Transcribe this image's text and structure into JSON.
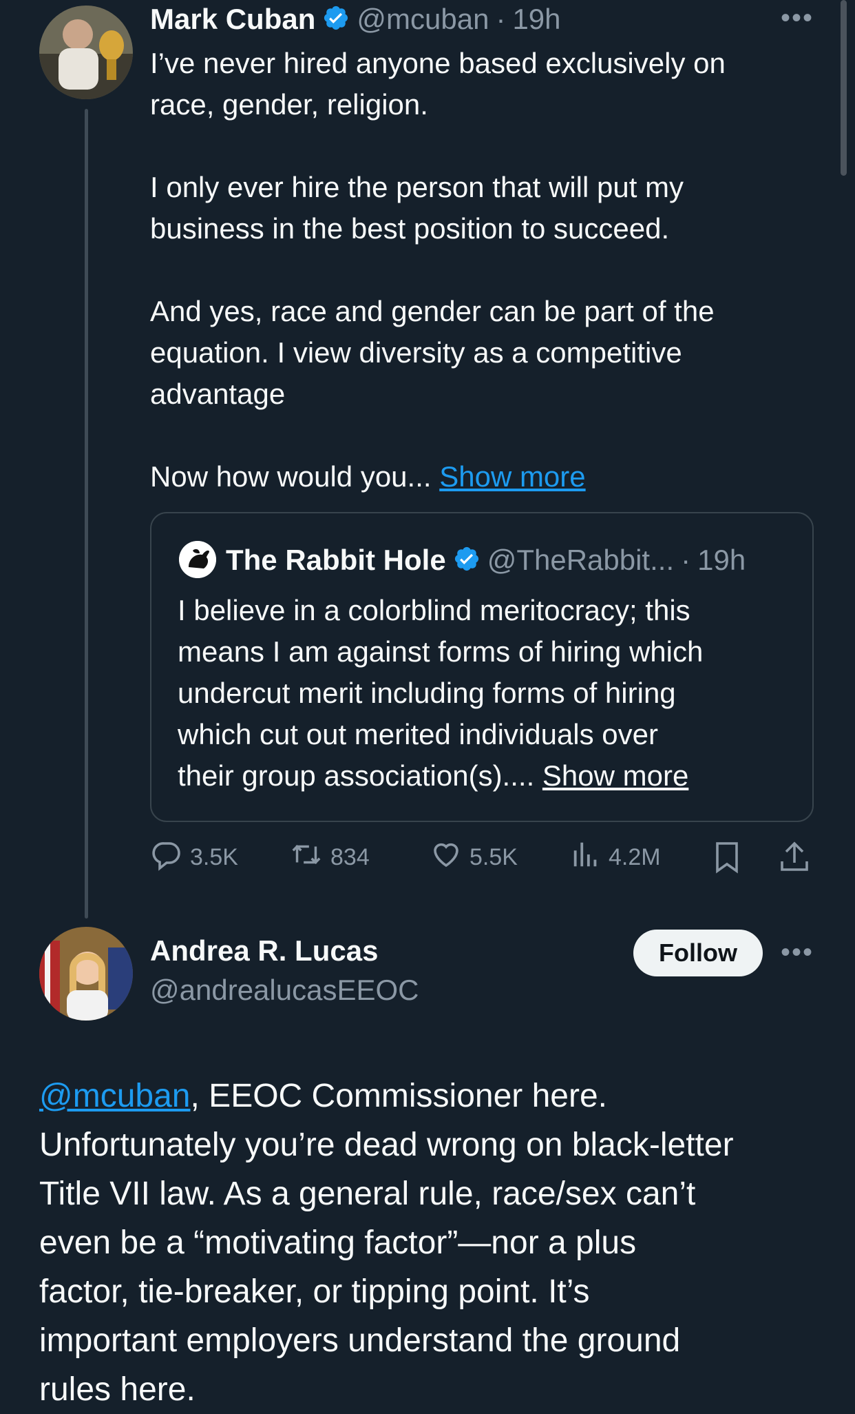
{
  "tweet": {
    "author_name": "Mark Cuban",
    "author_handle": "@mcuban",
    "separator": "·",
    "time": "19h",
    "lines": [
      "I’ve never hired anyone based exclusively on",
      "race, gender, religion.",
      "I only ever hire the person that will put my",
      "business in the best position to succeed.",
      "And yes, race and gender can be part of the",
      "equation. I view diversity as a competitive",
      "advantage",
      "Now how would you..."
    ],
    "show_more": "Show more",
    "quote": {
      "author_name": "The Rabbit Hole",
      "author_handle": "@TheRabbit...",
      "separator": "·",
      "time": "19h",
      "lines": [
        "I believe in a colorblind meritocracy; this",
        "means I am against forms of hiring which",
        "undercut merit including forms of hiring",
        "which cut out merited individuals over",
        "their group association(s)...."
      ],
      "show_more": "Show more"
    },
    "actions": {
      "replies": "3.5K",
      "retweets": "834",
      "likes": "5.5K",
      "views": "4.2M"
    }
  },
  "reply": {
    "author_name": "Andrea R. Lucas",
    "author_handle": "@andrealucasEEOC",
    "follow_label": "Follow",
    "mention": "@mcuban",
    "lines_first": ", EEOC Commissioner here.",
    "lines": [
      "Unfortunately you’re dead wrong on black-letter",
      "Title VII law. As a general rule, race/sex can’t",
      "even be a “motivating factor”—nor a plus",
      "factor, tie-breaker, or tipping point.  It’s",
      "important employers understand the ground",
      "rules here."
    ]
  },
  "icons": {
    "more": "more-icon",
    "verified": "verified-badge-icon",
    "reply": "reply-icon",
    "retweet": "retweet-icon",
    "like": "heart-icon",
    "views": "views-icon",
    "bookmark": "bookmark-icon",
    "share": "share-icon"
  },
  "colors": {
    "background": "#15202b",
    "accent": "#1d9bf0",
    "secondary_text": "#8b98a5"
  }
}
